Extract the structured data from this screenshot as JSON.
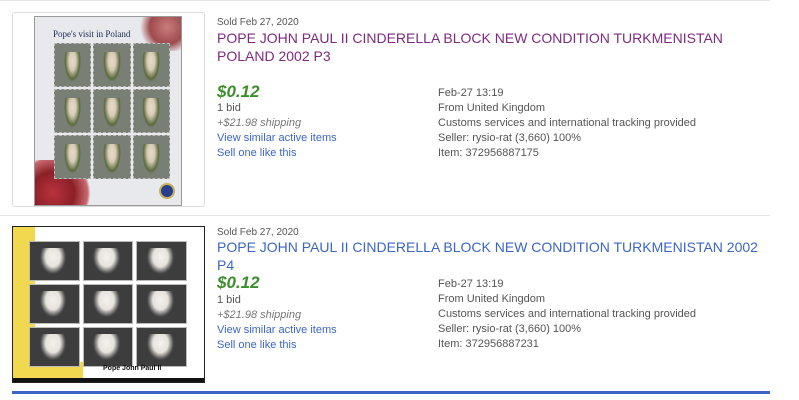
{
  "results": [
    {
      "sold_date": "Sold Feb 27, 2020",
      "title": "POPE JOHN PAUL II CINDERELLA BLOCK NEW CONDITION TURKMENISTAN POLAND 2002 P3",
      "price": "$0.12",
      "bids": "1 bid",
      "shipping": "+$21.98 shipping",
      "view_similar": "View similar active items",
      "sell_one": "Sell one like this",
      "end_time": "Feb-27 13:19",
      "location": "From United Kingdom",
      "services": "Customs services and international tracking provided",
      "seller": "Seller: rysio-rat (3,660) 100%",
      "item_number": "Item: 372956887175",
      "image_caption": "Pope's visit in Poland"
    },
    {
      "sold_date": "Sold Feb 27, 2020",
      "title": "POPE JOHN PAUL II CINDERELLA BLOCK NEW CONDITION TURKMENISTAN 2002 P4",
      "price": "$0.12",
      "bids": "1 bid",
      "shipping": "+$21.98 shipping",
      "view_similar": "View similar active items",
      "sell_one": "Sell one like this",
      "end_time": "Feb-27 13:19",
      "location": "From United Kingdom",
      "services": "Customs services and international tracking provided",
      "seller": "Seller: rysio-rat (3,660) 100%",
      "item_number": "Item: 372956887231",
      "image_caption": "Pope John Paul II"
    }
  ],
  "colors": {
    "visited_link": "#7d2a7f",
    "link": "#3b66c4",
    "price": "#3b8f2a"
  }
}
